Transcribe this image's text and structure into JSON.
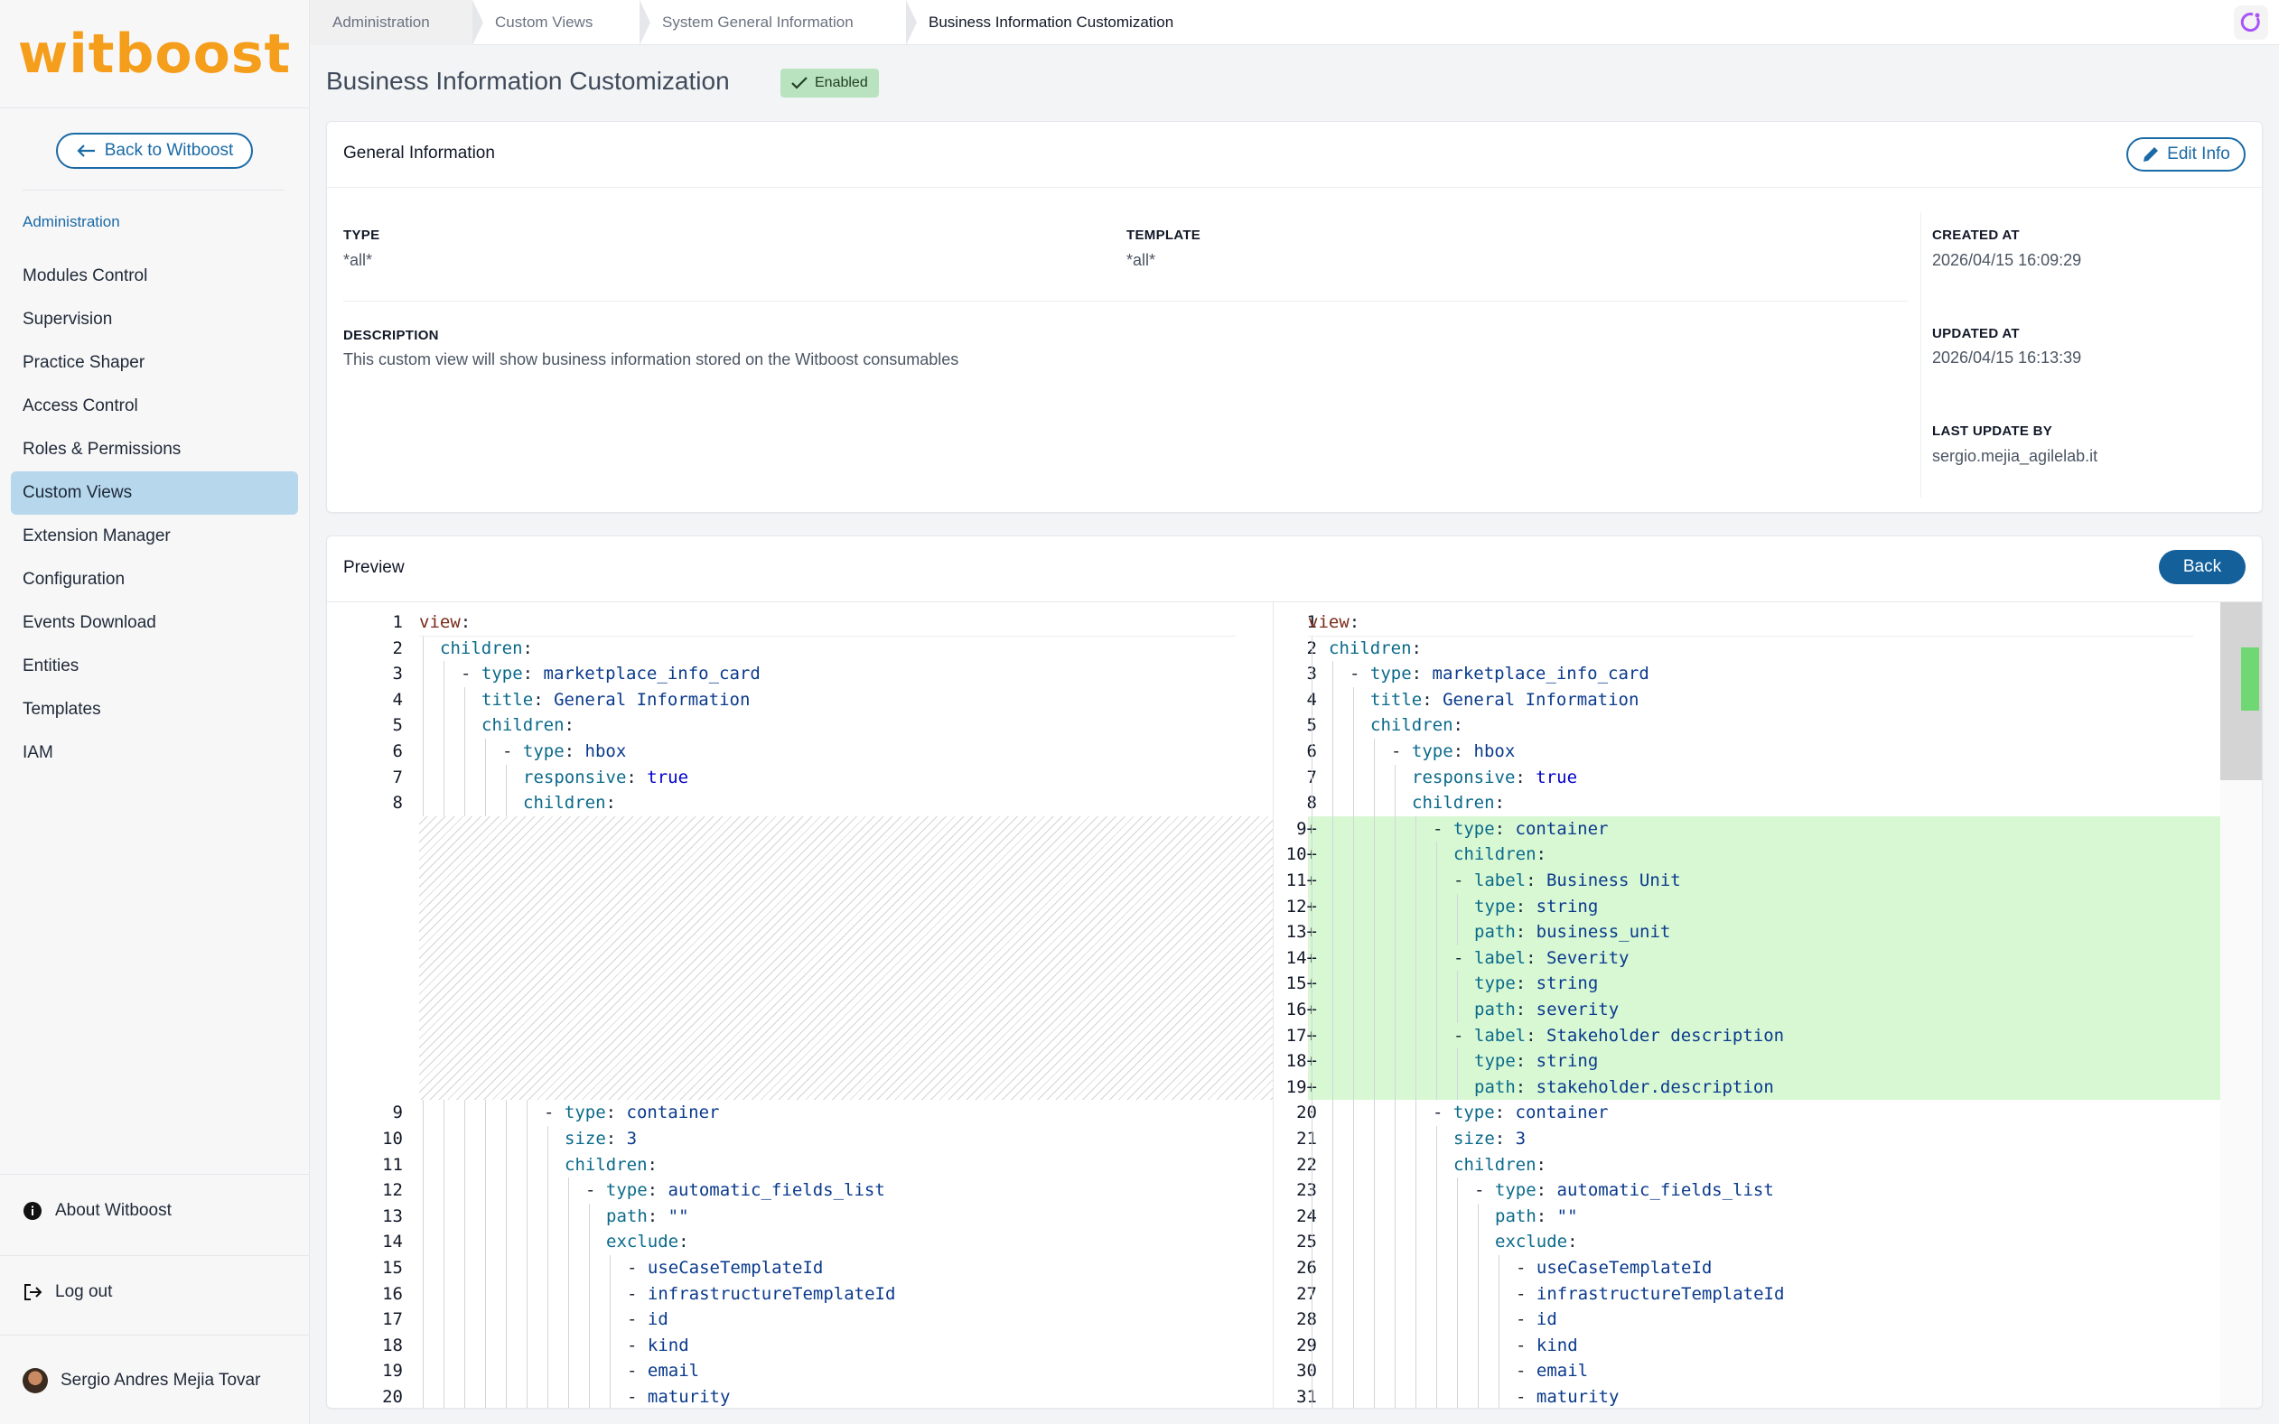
{
  "brand": {
    "logo_text": "witboost",
    "accent": "#f59e1b",
    "primary": "#1a6aa6"
  },
  "sidebar": {
    "back_label": "Back to Witboost",
    "section_title": "Administration",
    "items": [
      {
        "label": "Modules Control"
      },
      {
        "label": "Supervision"
      },
      {
        "label": "Practice Shaper"
      },
      {
        "label": "Access Control"
      },
      {
        "label": "Roles & Permissions"
      },
      {
        "label": "Custom Views",
        "active": true
      },
      {
        "label": "Extension Manager"
      },
      {
        "label": "Configuration"
      },
      {
        "label": "Events Download"
      },
      {
        "label": "Entities"
      },
      {
        "label": "Templates"
      },
      {
        "label": "IAM"
      }
    ],
    "about_label": "About Witboost",
    "logout_label": "Log out",
    "user_name": "Sergio Andres Mejia Tovar"
  },
  "breadcrumbs": [
    "Administration",
    "Custom Views",
    "System General Information",
    "Business Information Customization"
  ],
  "page": {
    "title": "Business Information Customization",
    "status": "Enabled"
  },
  "general": {
    "title": "General Information",
    "edit_label": "Edit Info",
    "type_label": "TYPE",
    "type_value": "*all*",
    "template_label": "TEMPLATE",
    "template_value": "*all*",
    "description_label": "DESCRIPTION",
    "description_value": "This custom view will show business information stored on the Witboost consumables",
    "created_label": "CREATED AT",
    "created_value": "2026/04/15 16:09:29",
    "updated_label": "UPDATED AT",
    "updated_value": "2026/04/15 16:13:39",
    "last_update_label": "LAST UPDATE BY",
    "last_update_value": "sergio.mejia_agilelab.it"
  },
  "preview": {
    "title": "Preview",
    "back_label": "Back",
    "left_lines": [
      {
        "n": "1",
        "indent": 0,
        "key": "view",
        "sep": ":",
        "val": ""
      },
      {
        "n": "2",
        "indent": 1,
        "key": "children",
        "sep": ":",
        "val": ""
      },
      {
        "n": "3",
        "indent": 2,
        "dash": true,
        "key": "type",
        "sep": ":",
        "val": "marketplace_info_card"
      },
      {
        "n": "4",
        "indent": 3,
        "key": "title",
        "sep": ":",
        "val": "General Information"
      },
      {
        "n": "5",
        "indent": 3,
        "key": "children",
        "sep": ":",
        "val": ""
      },
      {
        "n": "6",
        "indent": 4,
        "dash": true,
        "key": "type",
        "sep": ":",
        "val": "hbox"
      },
      {
        "n": "7",
        "indent": 5,
        "key": "responsive",
        "sep": ":",
        "val": "true",
        "bool": true
      },
      {
        "n": "8",
        "indent": 5,
        "key": "children",
        "sep": ":",
        "val": ""
      },
      {
        "n": "9",
        "indent": 6,
        "dash": true,
        "key": "type",
        "sep": ":",
        "val": "container"
      },
      {
        "n": "10",
        "indent": 7,
        "key": "size",
        "sep": ":",
        "val": "3"
      },
      {
        "n": "11",
        "indent": 7,
        "key": "children",
        "sep": ":",
        "val": ""
      },
      {
        "n": "12",
        "indent": 8,
        "dash": true,
        "key": "type",
        "sep": ":",
        "val": "automatic_fields_list"
      },
      {
        "n": "13",
        "indent": 9,
        "key": "path",
        "sep": ":",
        "val": "\"\""
      },
      {
        "n": "14",
        "indent": 9,
        "key": "exclude",
        "sep": ":",
        "val": ""
      },
      {
        "n": "15",
        "indent": 10,
        "dash": true,
        "key": "",
        "sep": "",
        "val": "useCaseTemplateId"
      },
      {
        "n": "16",
        "indent": 10,
        "dash": true,
        "key": "",
        "sep": "",
        "val": "infrastructureTemplateId"
      },
      {
        "n": "17",
        "indent": 10,
        "dash": true,
        "key": "",
        "sep": "",
        "val": "id"
      },
      {
        "n": "18",
        "indent": 10,
        "dash": true,
        "key": "",
        "sep": "",
        "val": "kind"
      },
      {
        "n": "19",
        "indent": 10,
        "dash": true,
        "key": "",
        "sep": "",
        "val": "email"
      },
      {
        "n": "20",
        "indent": 10,
        "dash": true,
        "key": "",
        "sep": "",
        "val": "maturity"
      }
    ],
    "right_lines": [
      {
        "n": "1",
        "indent": 0,
        "key": "view",
        "sep": ":",
        "val": ""
      },
      {
        "n": "2",
        "indent": 1,
        "key": "children",
        "sep": ":",
        "val": ""
      },
      {
        "n": "3",
        "indent": 2,
        "dash": true,
        "key": "type",
        "sep": ":",
        "val": "marketplace_info_card"
      },
      {
        "n": "4",
        "indent": 3,
        "key": "title",
        "sep": ":",
        "val": "General Information"
      },
      {
        "n": "5",
        "indent": 3,
        "key": "children",
        "sep": ":",
        "val": ""
      },
      {
        "n": "6",
        "indent": 4,
        "dash": true,
        "key": "type",
        "sep": ":",
        "val": "hbox"
      },
      {
        "n": "7",
        "indent": 5,
        "key": "responsive",
        "sep": ":",
        "val": "true",
        "bool": true
      },
      {
        "n": "8",
        "indent": 5,
        "key": "children",
        "sep": ":",
        "val": ""
      },
      {
        "n": "9",
        "added": true,
        "indent": 6,
        "dash": true,
        "key": "type",
        "sep": ":",
        "val": "container"
      },
      {
        "n": "10",
        "added": true,
        "indent": 7,
        "key": "children",
        "sep": ":",
        "val": ""
      },
      {
        "n": "11",
        "added": true,
        "indent": 7,
        "dash": true,
        "key": "label",
        "sep": ":",
        "val": "Business Unit"
      },
      {
        "n": "12",
        "added": true,
        "indent": 8,
        "key": "type",
        "sep": ":",
        "val": "string"
      },
      {
        "n": "13",
        "added": true,
        "indent": 8,
        "key": "path",
        "sep": ":",
        "val": "business_unit"
      },
      {
        "n": "14",
        "added": true,
        "indent": 7,
        "dash": true,
        "key": "label",
        "sep": ":",
        "val": "Severity"
      },
      {
        "n": "15",
        "added": true,
        "indent": 8,
        "key": "type",
        "sep": ":",
        "val": "string"
      },
      {
        "n": "16",
        "added": true,
        "indent": 8,
        "key": "path",
        "sep": ":",
        "val": "severity"
      },
      {
        "n": "17",
        "added": true,
        "indent": 7,
        "dash": true,
        "key": "label",
        "sep": ":",
        "val": "Stakeholder description"
      },
      {
        "n": "18",
        "added": true,
        "indent": 8,
        "key": "type",
        "sep": ":",
        "val": "string"
      },
      {
        "n": "19",
        "added": true,
        "indent": 8,
        "key": "path",
        "sep": ":",
        "val": "stakeholder.description"
      },
      {
        "n": "20",
        "indent": 6,
        "dash": true,
        "key": "type",
        "sep": ":",
        "val": "container"
      },
      {
        "n": "21",
        "indent": 7,
        "key": "size",
        "sep": ":",
        "val": "3"
      },
      {
        "n": "22",
        "indent": 7,
        "key": "children",
        "sep": ":",
        "val": ""
      },
      {
        "n": "23",
        "indent": 8,
        "dash": true,
        "key": "type",
        "sep": ":",
        "val": "automatic_fields_list"
      },
      {
        "n": "24",
        "indent": 9,
        "key": "path",
        "sep": ":",
        "val": "\"\""
      },
      {
        "n": "25",
        "indent": 9,
        "key": "exclude",
        "sep": ":",
        "val": ""
      },
      {
        "n": "26",
        "indent": 10,
        "dash": true,
        "key": "",
        "sep": "",
        "val": "useCaseTemplateId"
      },
      {
        "n": "27",
        "indent": 10,
        "dash": true,
        "key": "",
        "sep": "",
        "val": "infrastructureTemplateId"
      },
      {
        "n": "28",
        "indent": 10,
        "dash": true,
        "key": "",
        "sep": "",
        "val": "id"
      },
      {
        "n": "29",
        "indent": 10,
        "dash": true,
        "key": "",
        "sep": "",
        "val": "kind"
      },
      {
        "n": "30",
        "indent": 10,
        "dash": true,
        "key": "",
        "sep": "",
        "val": "email"
      },
      {
        "n": "31",
        "indent": 10,
        "dash": true,
        "key": "",
        "sep": "",
        "val": "maturity"
      }
    ]
  }
}
